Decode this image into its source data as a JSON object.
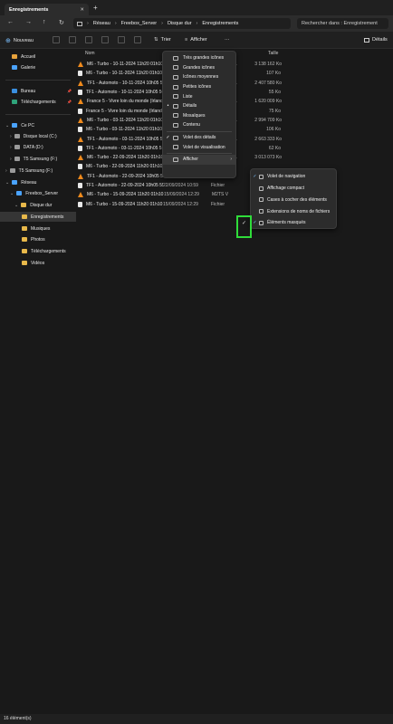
{
  "window": {
    "tab_title": "Enregistrements",
    "tab_close": "✕",
    "new_tab": "+"
  },
  "nav": {
    "back": "←",
    "forward": "→",
    "up": "↑",
    "refresh": "↻",
    "expand": "›"
  },
  "breadcrumb": [
    "Réseau",
    "Freebox_Server",
    "Disque dur",
    "Enregistrements"
  ],
  "search": {
    "placeholder": "Rechercher dans : Enregistrement"
  },
  "toolbar": {
    "new_label": "Nouveau",
    "sort_label": "Trier",
    "view_label": "Afficher",
    "more": "···",
    "details_label": "Détails"
  },
  "sidebar": {
    "quick": [
      {
        "label": "Accueil",
        "color": "#e8a33c"
      },
      {
        "label": "Galerie",
        "color": "#4aa3ff"
      }
    ],
    "pinned": [
      {
        "label": "Bureau",
        "color": "#3a8fe0",
        "pin": "📌"
      },
      {
        "label": "Téléchargements",
        "color": "#2fa37a",
        "pin": "📌"
      }
    ],
    "this_pc": "Ce PC",
    "drives": [
      "Disque local (C:)",
      "DATA (D:)",
      "T5 Samsung (F:)"
    ],
    "t5": "T5 Samsung (F:)",
    "network": "Réseau",
    "server": "Freebox_Server",
    "disk": "Disque dur",
    "folders": [
      "Enregistrements",
      "Musiques",
      "Photos",
      "Téléchargements",
      "Vidéos"
    ]
  },
  "columns": {
    "name": "Nom",
    "size": "Taille"
  },
  "files": [
    {
      "name": "M6 - Turbo - 10-11-2024 11h20 01h10 (...)",
      "date": "",
      "type": "deo File (V...",
      "size": "3 138 162 Ko",
      "icon": "vlc"
    },
    {
      "name": "M6 - Turbo - 10-11-2024 11h20 01h10 (...)",
      "date": "",
      "type": "DX",
      "size": "107 Ko",
      "icon": "doc"
    },
    {
      "name": "TF1 - Automoto - 10-11-2024 10h05 50n",
      "date": "",
      "type": "deo File (V...",
      "size": "2 407 580 Ko",
      "icon": "vlc"
    },
    {
      "name": "TF1 - Automoto - 10-11-2024 10h05 50n",
      "date": "",
      "type": "DX",
      "size": "55 Ko",
      "icon": "doc"
    },
    {
      "name": "France 5 - Vivre loin du monde (Irlande",
      "date": "",
      "type": "deo File (V...",
      "size": "1 620 009 Ko",
      "icon": "vlc"
    },
    {
      "name": "France 5 - Vivre loin du monde (Irlande",
      "date": "",
      "type": "DX",
      "size": "75 Ko",
      "icon": "doc"
    },
    {
      "name": "M6 - Turbo - 03-11-2024 11h20 01h10 (...)",
      "date": "",
      "type": "deo File (V...",
      "size": "2 994 709 Ko",
      "icon": "vlc"
    },
    {
      "name": "M6 - Turbo - 03-11-2024 11h20 01h10 (...)",
      "date": "",
      "type": "DX",
      "size": "106 Ko",
      "icon": "doc"
    },
    {
      "name": "TF1 - Automoto - 03-11-2024 10h05 55n",
      "date": "",
      "type": "deo File (V...",
      "size": "2 663 333 Ko",
      "icon": "vlc"
    },
    {
      "name": "TF1 - Automoto - 03-11-2024 10h05 55n",
      "date": "",
      "type": "DX",
      "size": "62 Ko",
      "icon": "doc"
    },
    {
      "name": "M6 - Turbo - 22-09-2024 11h20 01h10 (...)",
      "date": "",
      "type": "deo File (V...",
      "size": "3 013 073 Ko",
      "icon": "vlc"
    },
    {
      "name": "M6 - Turbo - 22-09-2024 11h20 01h10 (...)",
      "date": "",
      "type": "DX",
      "size": "",
      "icon": "doc"
    },
    {
      "name": "TF1 - Automoto - 22-09-2024 10h05 55m...",
      "date": "22/09/2024 10:59",
      "type": "M2TS V",
      "size": "",
      "icon": "vlc"
    },
    {
      "name": "TF1 - Automoto - 22-09-2024 10h05 55m...",
      "date": "22/09/2024 10:59",
      "type": "Fichier",
      "size": "",
      "icon": "doc"
    },
    {
      "name": "M6 - Turbo - 15-09-2024 11h20 01h10 (...)",
      "date": "15/09/2024 12:29",
      "type": "M2TS V",
      "size": "",
      "icon": "vlc"
    },
    {
      "name": "M6 - Turbo - 15-09-2024 11h20 01h10 (...)",
      "date": "15/09/2024 12:29",
      "type": "Fichier",
      "size": "",
      "icon": "doc"
    }
  ],
  "view_menu": [
    {
      "label": "Très grandes icônes",
      "check": ""
    },
    {
      "label": "Grandes icônes",
      "check": ""
    },
    {
      "label": "Icônes moyennes",
      "check": ""
    },
    {
      "label": "Petites icônes",
      "check": ""
    },
    {
      "label": "Liste",
      "check": ""
    },
    {
      "label": "Détails",
      "check": "•"
    },
    {
      "label": "Mosaïques",
      "check": ""
    },
    {
      "label": "Contenu",
      "check": ""
    },
    {
      "label": "Volet des détails",
      "check": "✓"
    },
    {
      "label": "Volet de visualisation",
      "check": ""
    },
    {
      "label": "Afficher",
      "check": "",
      "arrow": "›"
    }
  ],
  "show_submenu": [
    {
      "label": "Volet de navigation",
      "check": "✓"
    },
    {
      "label": "Affichage compact",
      "check": ""
    },
    {
      "label": "Cases à cocher des éléments",
      "check": ""
    },
    {
      "label": "Extensions de noms de fichiers",
      "check": ""
    },
    {
      "label": "Éléments masqués",
      "check": "✓"
    }
  ],
  "highlight_check": "✓",
  "status": {
    "count": "16 élément(s)"
  }
}
